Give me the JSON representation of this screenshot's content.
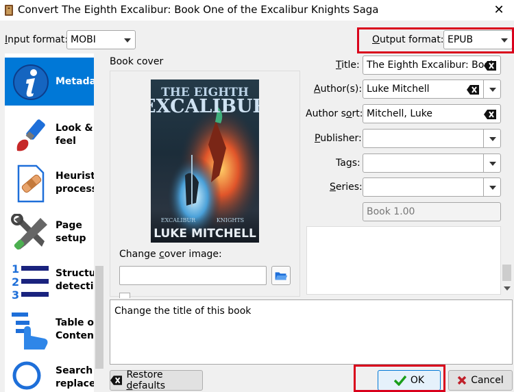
{
  "window": {
    "title": "Convert The Eighth Excalibur: Book One of the Excalibur Knights Saga",
    "close_glyph": "✕"
  },
  "input_format": {
    "label_pre": "",
    "label_ul": "I",
    "label_post": "nput format:",
    "value": "MOBI"
  },
  "output_format": {
    "label_ul": "O",
    "label_post": "utput format:",
    "value": "EPUB"
  },
  "sidebar": {
    "items": [
      {
        "line1": "Metadata",
        "line2": "",
        "icon": "info-icon"
      },
      {
        "line1": "Look &",
        "line2": "feel",
        "icon": "paintbrush-icon"
      },
      {
        "line1": "Heuristic",
        "line2": "processing",
        "icon": "bandage-document-icon"
      },
      {
        "line1": "Page",
        "line2": "setup",
        "icon": "tools-icon"
      },
      {
        "line1": "Structure",
        "line2": "detection",
        "icon": "numbered-list-icon"
      },
      {
        "line1": "Table of",
        "line2": "Contents",
        "icon": "toc-hand-icon"
      },
      {
        "line1": "Search &",
        "line2": "replace",
        "icon": "magnifier-icon"
      }
    ]
  },
  "cover": {
    "group_label": "Book cover",
    "art_title_1": "THE EIGHTH",
    "art_title_2": "EXCALIBUR",
    "art_series": "EXCALIBUR",
    "art_series_2": "KNIGHTS",
    "art_author": "LUKE MITCHELL",
    "change_label_pre": "Change ",
    "change_label_ul": "c",
    "change_label_post": "over image:",
    "path_value": ""
  },
  "fields": {
    "title_label_ul": "T",
    "title_label_post": "itle:",
    "title_value": "The Eighth Excalibur: Book",
    "authors_label_ul": "A",
    "authors_label_post": "uthor(s):",
    "authors_value": "Luke Mitchell",
    "author_sort_label": "Author s",
    "author_sort_label_ul": "o",
    "author_sort_label_post": "rt:",
    "author_sort_value": "Mitchell, Luke",
    "publisher_label_ul": "P",
    "publisher_label_post": "ublisher:",
    "publisher_value": "",
    "tags_label_pre": "Ta",
    "tags_label_ul": "g",
    "tags_label_post": "s:",
    "tags_value": "",
    "series_label_pre": "",
    "series_label_ul": "S",
    "series_label_post": "eries:",
    "series_value": "",
    "series_index": "Book 1.00"
  },
  "description": "Change the title of this book",
  "buttons": {
    "restore_pre": "Restore ",
    "restore_ul": "d",
    "restore_post": "efaults",
    "ok": "OK",
    "cancel": "Cancel"
  },
  "colors": {
    "selected": "#0078d7",
    "highlight": "#d9001b",
    "ok_check": "#1a9e1a",
    "cancel_x": "#c0202a"
  }
}
